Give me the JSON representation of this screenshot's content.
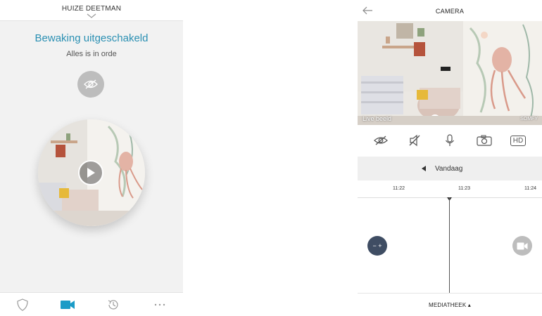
{
  "left_screen": {
    "header_title": "HUIZE DEETMAN",
    "status_title": "Bewaking uitgeschakeld",
    "status_subtitle": "Alles is in orde",
    "nav": [
      {
        "icon": "shield-icon"
      },
      {
        "icon": "video-camera-icon"
      },
      {
        "icon": "history-icon"
      },
      {
        "icon": "more-dots-icon"
      }
    ],
    "accent_color": "#2b90b3",
    "active_nav_color": "#1a9bc7"
  },
  "right_screen": {
    "header_title": "CAMERA",
    "live_label": "Live beeld",
    "camera_brand": "SOMFY",
    "toolbar": [
      {
        "icon": "eye-off-icon"
      },
      {
        "icon": "speaker-mute-icon"
      },
      {
        "icon": "microphone-icon"
      },
      {
        "icon": "camera-snapshot-icon"
      },
      {
        "icon": "hd-badge",
        "label": "HD"
      }
    ],
    "date_label": "Vandaag",
    "timeline_ticks": [
      "11:22",
      "11:23",
      "11:24"
    ],
    "zoom_label": "− +",
    "media_label": "MEDIATHEEK ▴"
  }
}
